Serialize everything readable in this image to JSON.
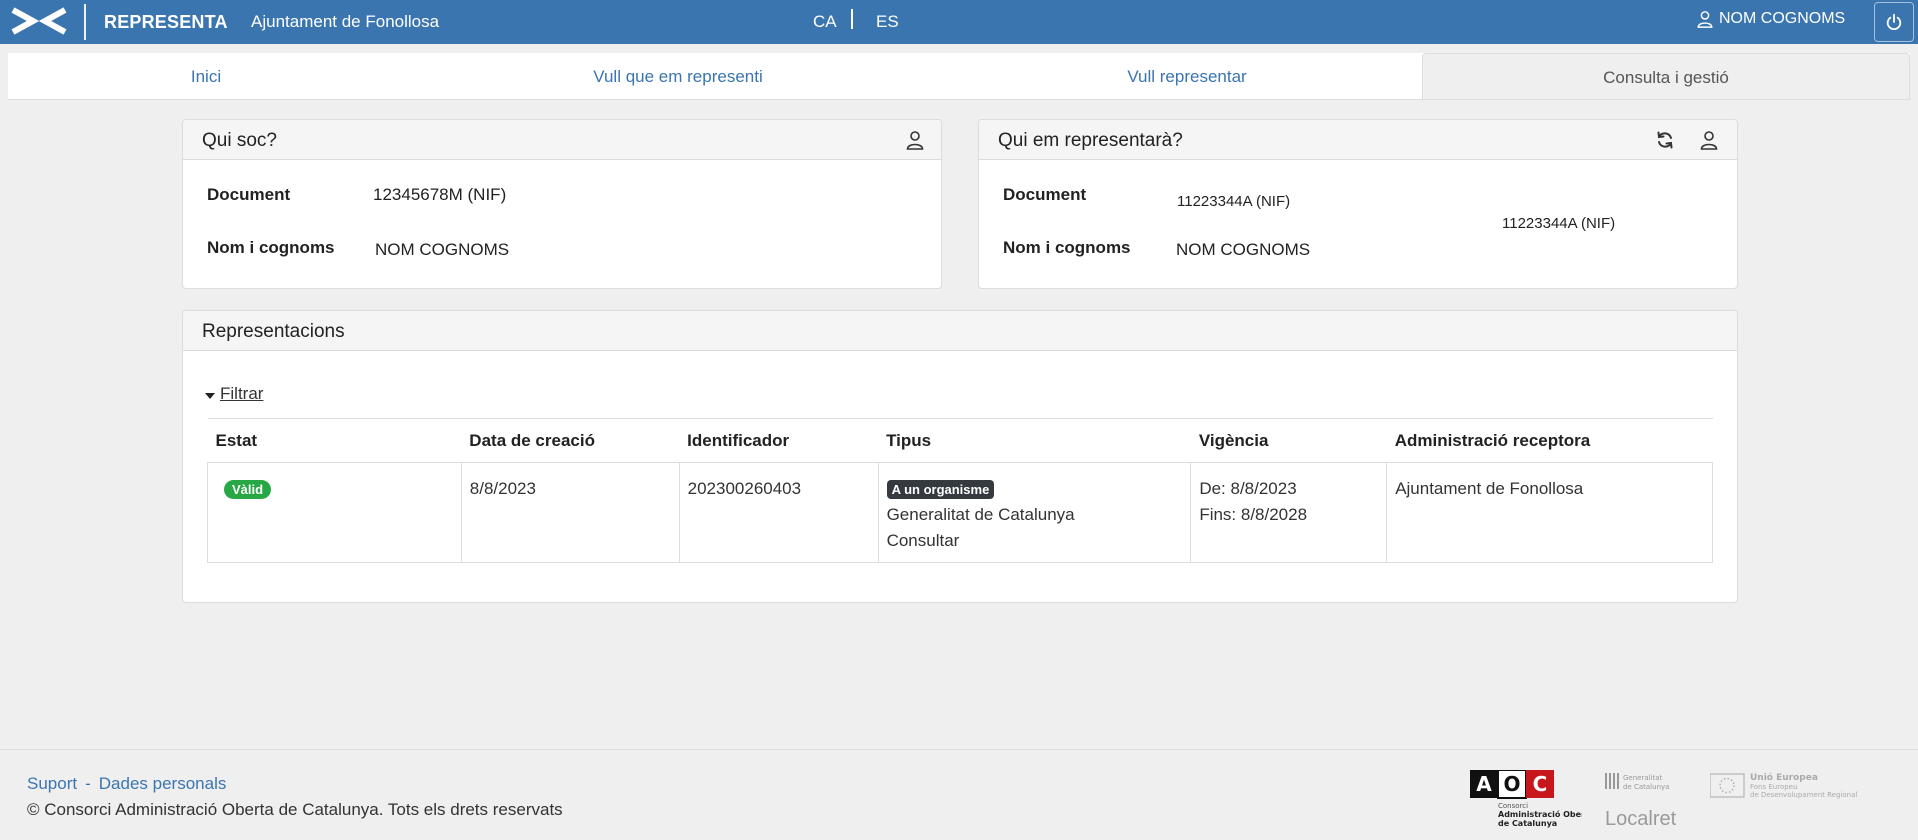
{
  "header": {
    "app_name": "REPRESENTA",
    "entity": "Ajuntament de Fonollosa",
    "languages": [
      "CA",
      "ES"
    ],
    "user_name": "NOM COGNOMS",
    "brand_color": "#3a75af"
  },
  "tabs": [
    {
      "label": "Inici",
      "active": false
    },
    {
      "label": "Vull que em representi",
      "active": false
    },
    {
      "label": "Vull representar",
      "active": false
    },
    {
      "label": "Consulta i gestió",
      "active": true
    }
  ],
  "qui_soc": {
    "title": "Qui soc?",
    "document_label": "Document",
    "document_value": "12345678M (NIF)",
    "name_label": "Nom i cognoms",
    "name_value": "NOM COGNOMS"
  },
  "qui_representara": {
    "title": "Qui em representarà?",
    "document_label": "Document",
    "document_value": "11223344A (NIF)",
    "document_value_extra": "11223344A (NIF)",
    "name_label": "Nom i cognoms",
    "name_value": "NOM COGNOMS"
  },
  "representacions": {
    "title": "Representacions",
    "filter_label": "Filtrar",
    "columns": [
      "Estat",
      "Data de creació",
      "Identificador",
      "Tipus",
      "Vigència",
      "Administració receptora"
    ],
    "rows": [
      {
        "estat": "Vàlid",
        "data_creacio": "8/8/2023",
        "identificador": "202300260403",
        "tipus_badge": "A un organisme",
        "tipus_organisme": "Generalitat de Catalunya",
        "tipus_accio": "Consultar",
        "vigencia_de": "De: 8/8/2023",
        "vigencia_fins": "Fins: 8/8/2028",
        "administracio": "Ajuntament de Fonollosa"
      }
    ]
  },
  "footer": {
    "links": [
      "Suport",
      "Dades personals"
    ],
    "separator": "-",
    "copyright": "© Consorci Administració Oberta de Catalunya. Tots els drets reservats",
    "aoc_logo_text": [
      "AOC",
      "Consorci",
      "Administració Oberta",
      "de Catalunya"
    ],
    "gencat_logo_text": [
      "Generalitat",
      "de Catalunya"
    ],
    "localret_logo_text": "Localret",
    "eu_logo_text": [
      "Unió Europea",
      "Fons Europeu",
      "de Desenvolupament Regional"
    ]
  }
}
